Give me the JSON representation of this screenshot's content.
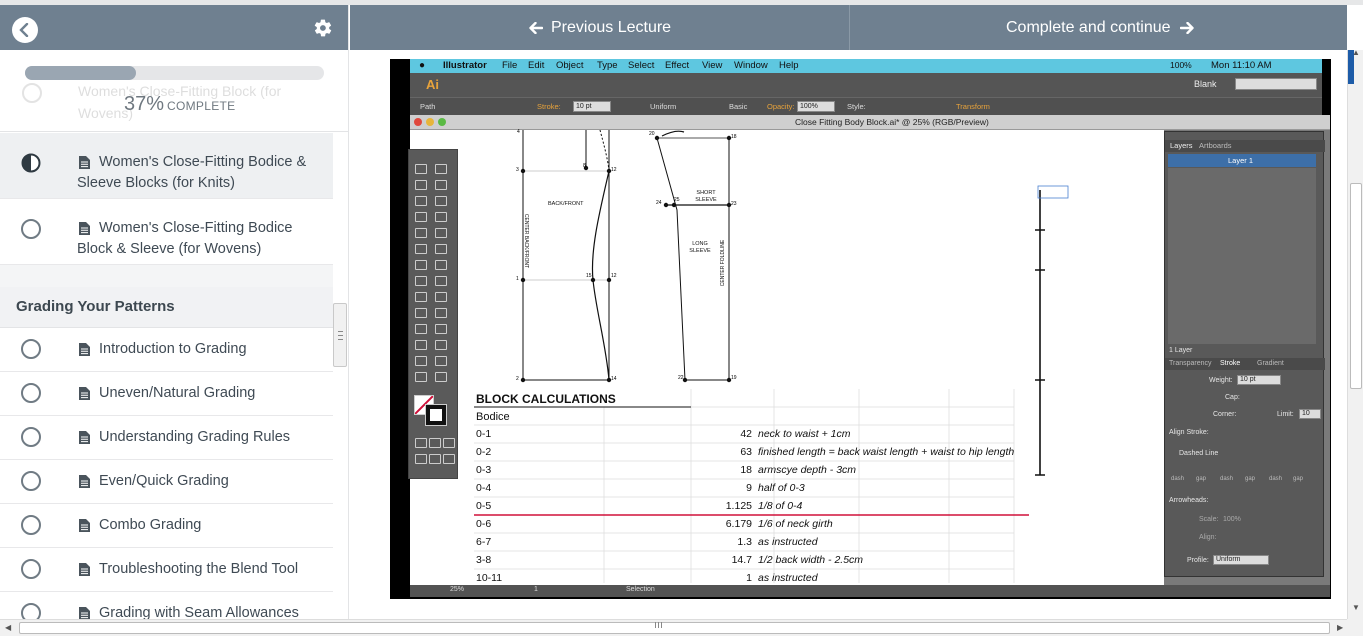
{
  "progress": {
    "percent": 37,
    "percent_text": "37%",
    "complete_label": "COMPLETE"
  },
  "ghost_lecture": "Women's Close-Fitting Block (for Wovens)",
  "nav": {
    "previous_label": "Previous Lecture",
    "next_label": "Complete and continue"
  },
  "lectures_top": [
    {
      "title": "Women's Close-Fitting Bodice & Sleeve Blocks (for Knits)",
      "status": "in-progress"
    },
    {
      "title": "Women's Close-Fitting Bodice Block & Sleeve (for Wovens)",
      "status": "incomplete"
    }
  ],
  "section": {
    "title": "Grading Your Patterns",
    "lectures": [
      {
        "title": "Introduction to Grading"
      },
      {
        "title": "Uneven/Natural Grading"
      },
      {
        "title": "Understanding Grading Rules"
      },
      {
        "title": "Even/Quick Grading"
      },
      {
        "title": "Combo Grading"
      },
      {
        "title": "Troubleshooting the Blend Tool"
      },
      {
        "title": "Grading with Seam Allowances"
      }
    ]
  },
  "video": {
    "menubar": {
      "app": "Illustrator",
      "menus": [
        "File",
        "Edit",
        "Object",
        "Type",
        "Select",
        "Effect",
        "View",
        "Window",
        "Help"
      ],
      "battery": "100%",
      "clock": "Mon 11:10 AM"
    },
    "workspace": "Blank",
    "optionbar": {
      "path": "Path",
      "stroke_label": "Stroke:",
      "stroke_value": "10 pt",
      "uniform": "Uniform",
      "basic": "Basic",
      "opacity_label": "Opacity:",
      "opacity_value": "100%",
      "style_label": "Style:",
      "transform": "Transform"
    },
    "document_title": "Close Fitting Body Block.ai* @ 25% (RGB/Preview)",
    "pattern_labels": {
      "back_front": "BACK/FRONT",
      "center_back": "CENTER BACK/FRONT",
      "short_sleeve": "SHORT SLEEVE",
      "long_sleeve": "LONG SLEEVE",
      "center_fold": "CENTER FOLDLINE"
    },
    "points": [
      "4",
      "3",
      "1",
      "2",
      "8",
      "12",
      "15",
      "12",
      "14",
      "20",
      "18",
      "24",
      "25",
      "23",
      "22",
      "19"
    ],
    "panel": {
      "tabs": [
        "Layers",
        "Artboards"
      ],
      "layer": "Layer 1",
      "layer_count": "1 Layer",
      "stroke_tabs": [
        "Transparency",
        "Stroke",
        "Gradient"
      ],
      "weight_label": "Weight:",
      "weight_value": "10 pt",
      "cap_label": "Cap:",
      "corner_label": "Corner:",
      "limit_label": "Limit:",
      "limit_value": "10",
      "align_label": "Align Stroke:",
      "dashed_label": "Dashed Line",
      "dash_labels": [
        "dash",
        "gap",
        "dash",
        "gap",
        "dash",
        "gap"
      ],
      "arrowheads_label": "Arrowheads:",
      "scale_label": "Scale:",
      "scale_value": "100%",
      "align2_label": "Align:",
      "profile_label": "Profile:",
      "profile_value": "Uniform"
    },
    "status": {
      "zoom": "25%",
      "page": "1",
      "tool": "Selection"
    },
    "block_calculations": {
      "title": "BLOCK CALCULATIONS",
      "subtitle": "Bodice",
      "rows": [
        {
          "key": "0-1",
          "value": "42",
          "desc": "neck to waist + 1cm"
        },
        {
          "key": "0-2",
          "value": "63",
          "desc": "finished length = back waist length + waist to hip length"
        },
        {
          "key": "0-3",
          "value": "18",
          "desc": "armscye depth - 3cm"
        },
        {
          "key": "0-4",
          "value": "9",
          "desc": "half of 0-3"
        },
        {
          "key": "0-5",
          "value": "1.125",
          "desc": "1/8 of 0-4"
        },
        {
          "key": "0-6",
          "value": "6.179",
          "desc": "1/6 of neck girth"
        },
        {
          "key": "6-7",
          "value": "1.3",
          "desc": "as instructed"
        },
        {
          "key": "3-8",
          "value": "14.7",
          "desc": "1/2 back width - 2.5cm"
        },
        {
          "key": "10-11",
          "value": "1",
          "desc": "as instructed"
        }
      ]
    }
  },
  "colors": {
    "header": "#6f8090",
    "accent_red": "#d0103a",
    "menubar": "#5ec7e0"
  }
}
